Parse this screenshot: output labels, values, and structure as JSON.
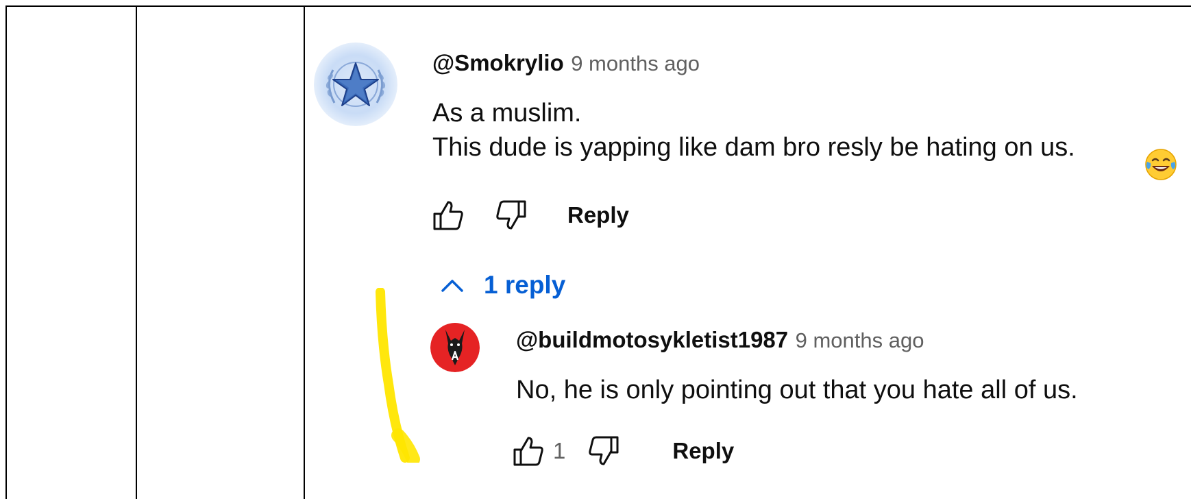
{
  "comment": {
    "author": "@Smokrylio",
    "timestamp": "9 months ago",
    "lines": [
      "As a muslim.",
      "This dude is yapping like dam bro resly be hating on us."
    ],
    "emoji_icon": "face-with-tears-of-joy-emoji",
    "actions": {
      "like_icon": "thumbs-up-icon",
      "dislike_icon": "thumbs-down-icon",
      "reply_label": "Reply"
    }
  },
  "replies_toggle": {
    "chevron_icon": "chevron-up-icon",
    "label": "1 reply",
    "color": "#065fd4"
  },
  "reply": {
    "author": "@buildmotosykletist1987",
    "timestamp": "9 months ago",
    "text": "No, he is only pointing out that you hate all of us.",
    "actions": {
      "like_icon": "thumbs-up-icon",
      "like_count": "1",
      "dislike_icon": "thumbs-down-icon",
      "reply_label": "Reply"
    }
  },
  "colors": {
    "primary_text": "#0f0f0f",
    "secondary_text": "#606060",
    "link_blue": "#065fd4",
    "highlighter": "#ffe600"
  }
}
